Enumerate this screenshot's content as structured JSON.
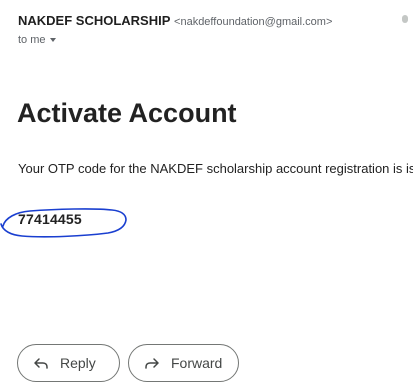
{
  "message": {
    "sender_name": "NAKDEF SCHOLARSHIP",
    "sender_email": "<nakdeffoundation@gmail.com>",
    "recipient_label": "to me"
  },
  "content": {
    "heading": "Activate Account",
    "body": "Your OTP code for the NAKDEF scholarship account registration is is",
    "otp_code": "77414455"
  },
  "actions": {
    "reply_label": "Reply",
    "forward_label": "Forward"
  },
  "icons": {
    "recipient_details": "chevron-down-icon",
    "reply": "reply-arrow-icon",
    "forward": "forward-arrow-icon"
  },
  "colors": {
    "annotation_circle": "#1a3fd0",
    "button_border": "#747775",
    "secondary_text": "#5f6368"
  }
}
